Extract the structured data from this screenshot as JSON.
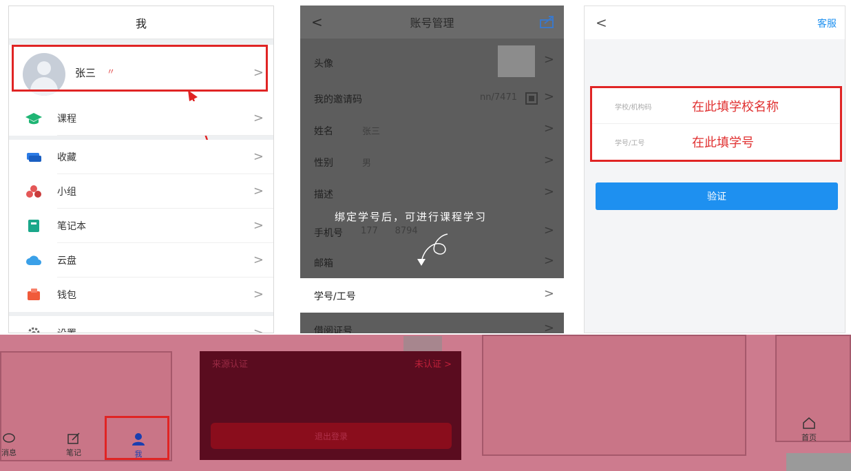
{
  "screen1": {
    "title": "我",
    "profile_name": "张三",
    "profile_mark": "〃",
    "chevron": ">",
    "menu": [
      {
        "label": "课程",
        "icon": "graduation-cap-icon",
        "color": "#1fb574"
      },
      {
        "label": "收藏",
        "icon": "bookmark-stack-icon",
        "color": "#2c7be5"
      },
      {
        "label": "小组",
        "icon": "group-icon",
        "color": "#e45757"
      },
      {
        "label": "笔记本",
        "icon": "notebook-icon",
        "color": "#1aa78a"
      },
      {
        "label": "云盘",
        "icon": "cloud-icon",
        "color": "#3aa0e8"
      },
      {
        "label": "钱包",
        "icon": "wallet-icon",
        "color": "#f05a3a"
      },
      {
        "label": "设置",
        "icon": "gear-icon",
        "color": "#666666"
      }
    ],
    "tabs": [
      {
        "label": "消息",
        "icon": "chat-bubble-icon"
      },
      {
        "label": "笔记",
        "icon": "edit-note-icon"
      },
      {
        "label": "我",
        "icon": "person-icon"
      }
    ]
  },
  "screen2": {
    "title": "账号管理",
    "back": "<",
    "chevron": ">",
    "rows": [
      {
        "label": "头像",
        "value": ""
      },
      {
        "label": "我的邀请码",
        "value": "nn/7471"
      },
      {
        "label": "姓名",
        "value": "张三"
      },
      {
        "label": "性别",
        "value": "男"
      },
      {
        "label": "描述",
        "value": ""
      },
      {
        "label": "手机号",
        "value": "177      8794"
      },
      {
        "label": "邮箱",
        "value": ""
      },
      {
        "label": "学号/工号",
        "value": ""
      },
      {
        "label": "借阅证号",
        "value": ""
      }
    ],
    "annotation": "绑定学号后，可进行课程学习",
    "lower_row_label": "来源认证",
    "lower_row_value": "未认证 >",
    "lower_button": "退出登录"
  },
  "screen3": {
    "back": "<",
    "service": "客服",
    "field1_label": "学校/机构码",
    "field1_hint": "在此填学校名称",
    "field2_label": "学号/工号",
    "field2_hint": "在此填学号",
    "verify_button": "验证",
    "home_tab": "首页"
  },
  "colors": {
    "accent_blue": "#1e90f0",
    "highlight_red": "#e02424",
    "pink_overlay": "#cd7b8e"
  }
}
